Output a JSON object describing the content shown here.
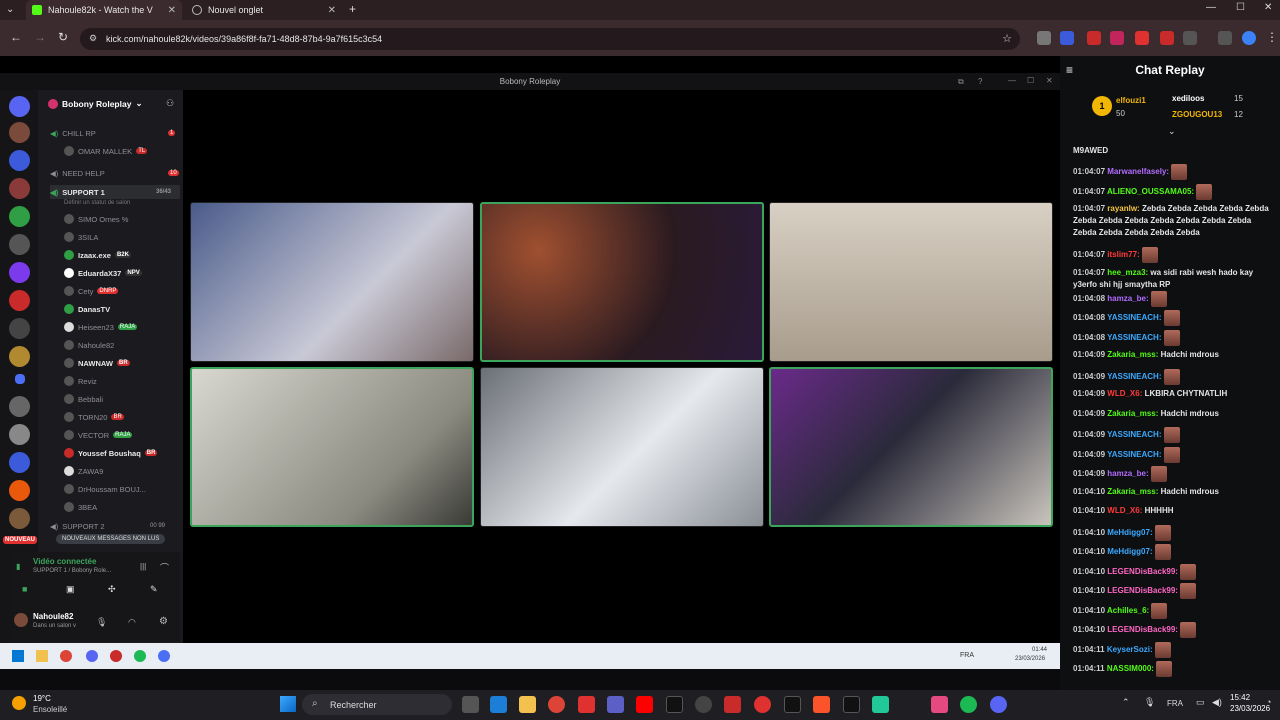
{
  "browser": {
    "tabs": [
      {
        "label": "Nahoule82k - Watch the V",
        "active": true
      },
      {
        "label": "Nouvel onglet",
        "active": false
      }
    ],
    "url": "kick.com/nahoule82k/videos/39a86f8f-fa71-48d8-87b4-9a7f615c3c54"
  },
  "discord": {
    "window_title": "Bobony Roleplay",
    "server_name": "Bobony Roleplay",
    "channels": [
      {
        "label": "CHILL RP",
        "type": "voice",
        "badge": "1"
      },
      {
        "label": "OMAR MALLEK",
        "type": "user",
        "tag": "TL"
      },
      {
        "label": "NEED HELP",
        "type": "voice",
        "badge": "10"
      },
      {
        "label": "SUPPORT 1",
        "type": "voice-active",
        "badge": "36/43"
      },
      {
        "label": "Définir un statut de salon",
        "type": "sub"
      },
      {
        "label": "SIMO Ornes %",
        "type": "user"
      },
      {
        "label": "3SILA",
        "type": "user"
      },
      {
        "label": "Izaax.exe",
        "type": "user",
        "tag": "B2K"
      },
      {
        "label": "EduardaX37",
        "type": "user",
        "tag": "NPV"
      },
      {
        "label": "Cety",
        "type": "user",
        "tag": "DNRP"
      },
      {
        "label": "DanasTV",
        "type": "user"
      },
      {
        "label": "Heiseen23",
        "type": "user",
        "tag": "RAJA"
      },
      {
        "label": "Nahoule82",
        "type": "user"
      },
      {
        "label": "NAWNAW",
        "type": "user",
        "tag": "BR"
      },
      {
        "label": "Reviz",
        "type": "user"
      },
      {
        "label": "Bebbali",
        "type": "user"
      },
      {
        "label": "TORN20",
        "type": "user",
        "tag": "BR"
      },
      {
        "label": "VECTOR",
        "type": "user",
        "tag": "RAJA"
      },
      {
        "label": "Youssef Boushaq",
        "type": "user",
        "tag": "BR"
      },
      {
        "label": "ZAWA9",
        "type": "user"
      },
      {
        "label": "DrHoussam BOUJ...",
        "type": "user"
      },
      {
        "label": "3BEA",
        "type": "user"
      },
      {
        "label": "SUPPORT 2",
        "type": "voice",
        "badge": "00 99"
      }
    ],
    "new_messages": "NOUVEAUX MESSAGES NON LUS",
    "new_badge": "NOUVEAU",
    "voice_status": "Vidéo connectée",
    "voice_sub": "SUPPORT 1 / Bobony Role...",
    "username": "Nahoule82",
    "user_status": "Dans un salon v"
  },
  "inner_taskbar": {
    "lang": "FRA",
    "time": "01:44",
    "date": "23/03/2026"
  },
  "chat": {
    "title": "Chat Replay",
    "leaderboard": [
      {
        "rank": "1",
        "name": "elfouzi1",
        "count": "50"
      },
      {
        "name": "xediloos",
        "count": "15"
      },
      {
        "name": "ZGOUGOU13",
        "count": "12"
      }
    ],
    "messages": [
      {
        "time": "",
        "user": "M9AWED",
        "text": "",
        "color": "#e5e5e5"
      },
      {
        "time": "01:04:07",
        "user": "Marwanelfasely:",
        "text": "",
        "color": "#b36cff",
        "emote": true
      },
      {
        "time": "01:04:07",
        "user": "ALIENO_OUSSAMA05:",
        "text": "",
        "color": "#53fc18",
        "emote": true
      },
      {
        "time": "01:04:07",
        "user": "rayanlw:",
        "text": "Zebda Zebda Zebda Zebda Zebda Zebda Zebda Zebda Zebda Zebda Zebda Zebda Zebda Zebda Zebda Zebda Zebda",
        "color": "#f5c542"
      },
      {
        "time": "01:04:07",
        "user": "itslim77:",
        "text": "",
        "color": "#ff3b3b",
        "emote": true
      },
      {
        "time": "01:04:07",
        "user": "hee_mza3:",
        "text": "wa sidi rabi wesh hado kay y3erfo shi hjj smaytha RP",
        "color": "#53fc18"
      },
      {
        "time": "01:04:08",
        "user": "hamza_be:",
        "text": "",
        "color": "#b36cff",
        "emote": true
      },
      {
        "time": "01:04:08",
        "user": "YASSINEACH:",
        "text": "",
        "color": "#3ba9ff",
        "emote": true
      },
      {
        "time": "01:04:08",
        "user": "YASSINEACH:",
        "text": "",
        "color": "#3ba9ff",
        "emote": true
      },
      {
        "time": "01:04:09",
        "user": "Zakaria_mss:",
        "text": "Hadchi mdrous",
        "color": "#53fc18"
      },
      {
        "time": "01:04:09",
        "user": "YASSINEACH:",
        "text": "",
        "color": "#3ba9ff",
        "emote": true
      },
      {
        "time": "01:04:09",
        "user": "WLD_X6:",
        "text": "LKBIRA CHYTNATLIH",
        "color": "#ff3b3b"
      },
      {
        "time": "01:04:09",
        "user": "Zakaria_mss:",
        "text": "Hadchi mdrous",
        "color": "#53fc18"
      },
      {
        "time": "01:04:09",
        "user": "YASSINEACH:",
        "text": "",
        "color": "#3ba9ff",
        "emote": true
      },
      {
        "time": "01:04:09",
        "user": "YASSINEACH:",
        "text": "",
        "color": "#3ba9ff",
        "emote": true
      },
      {
        "time": "01:04:09",
        "user": "hamza_be:",
        "text": "",
        "color": "#b36cff",
        "emote": true
      },
      {
        "time": "01:04:10",
        "user": "Zakaria_mss:",
        "text": "Hadchi mdrous",
        "color": "#53fc18"
      },
      {
        "time": "01:04:10",
        "user": "WLD_X6:",
        "text": "HHHHH",
        "color": "#ff3b3b"
      },
      {
        "time": "01:04:10",
        "user": "MeHdigg07:",
        "text": "",
        "color": "#3ba9ff",
        "emote": true
      },
      {
        "time": "01:04:10",
        "user": "MeHdigg07:",
        "text": "",
        "color": "#3ba9ff",
        "emote": true
      },
      {
        "time": "01:04:10",
        "user": "LEGENDisBack99:",
        "text": "",
        "color": "#ff66c4",
        "emote": true
      },
      {
        "time": "01:04:10",
        "user": "LEGENDisBack99:",
        "text": "",
        "color": "#ff66c4",
        "emote": true
      },
      {
        "time": "01:04:10",
        "user": "Achilles_6:",
        "text": "",
        "color": "#53fc18",
        "emote": true
      },
      {
        "time": "01:04:10",
        "user": "LEGENDisBack99:",
        "text": "",
        "color": "#ff66c4",
        "emote": true
      },
      {
        "time": "01:04:11",
        "user": "KeyserSozi:",
        "text": "",
        "color": "#3ba9ff",
        "emote": true
      },
      {
        "time": "01:04:11",
        "user": "NASSIM000:",
        "text": "",
        "color": "#53fc18",
        "emote": true
      }
    ]
  },
  "taskbar": {
    "weather_temp": "19°C",
    "weather_desc": "Ensoleillé",
    "search_placeholder": "Rechercher",
    "lang": "FRA",
    "time": "15:42",
    "date": "23/03/2026"
  },
  "colors": {
    "kick_green": "#53fc18",
    "speaking": "#3ba55c"
  }
}
